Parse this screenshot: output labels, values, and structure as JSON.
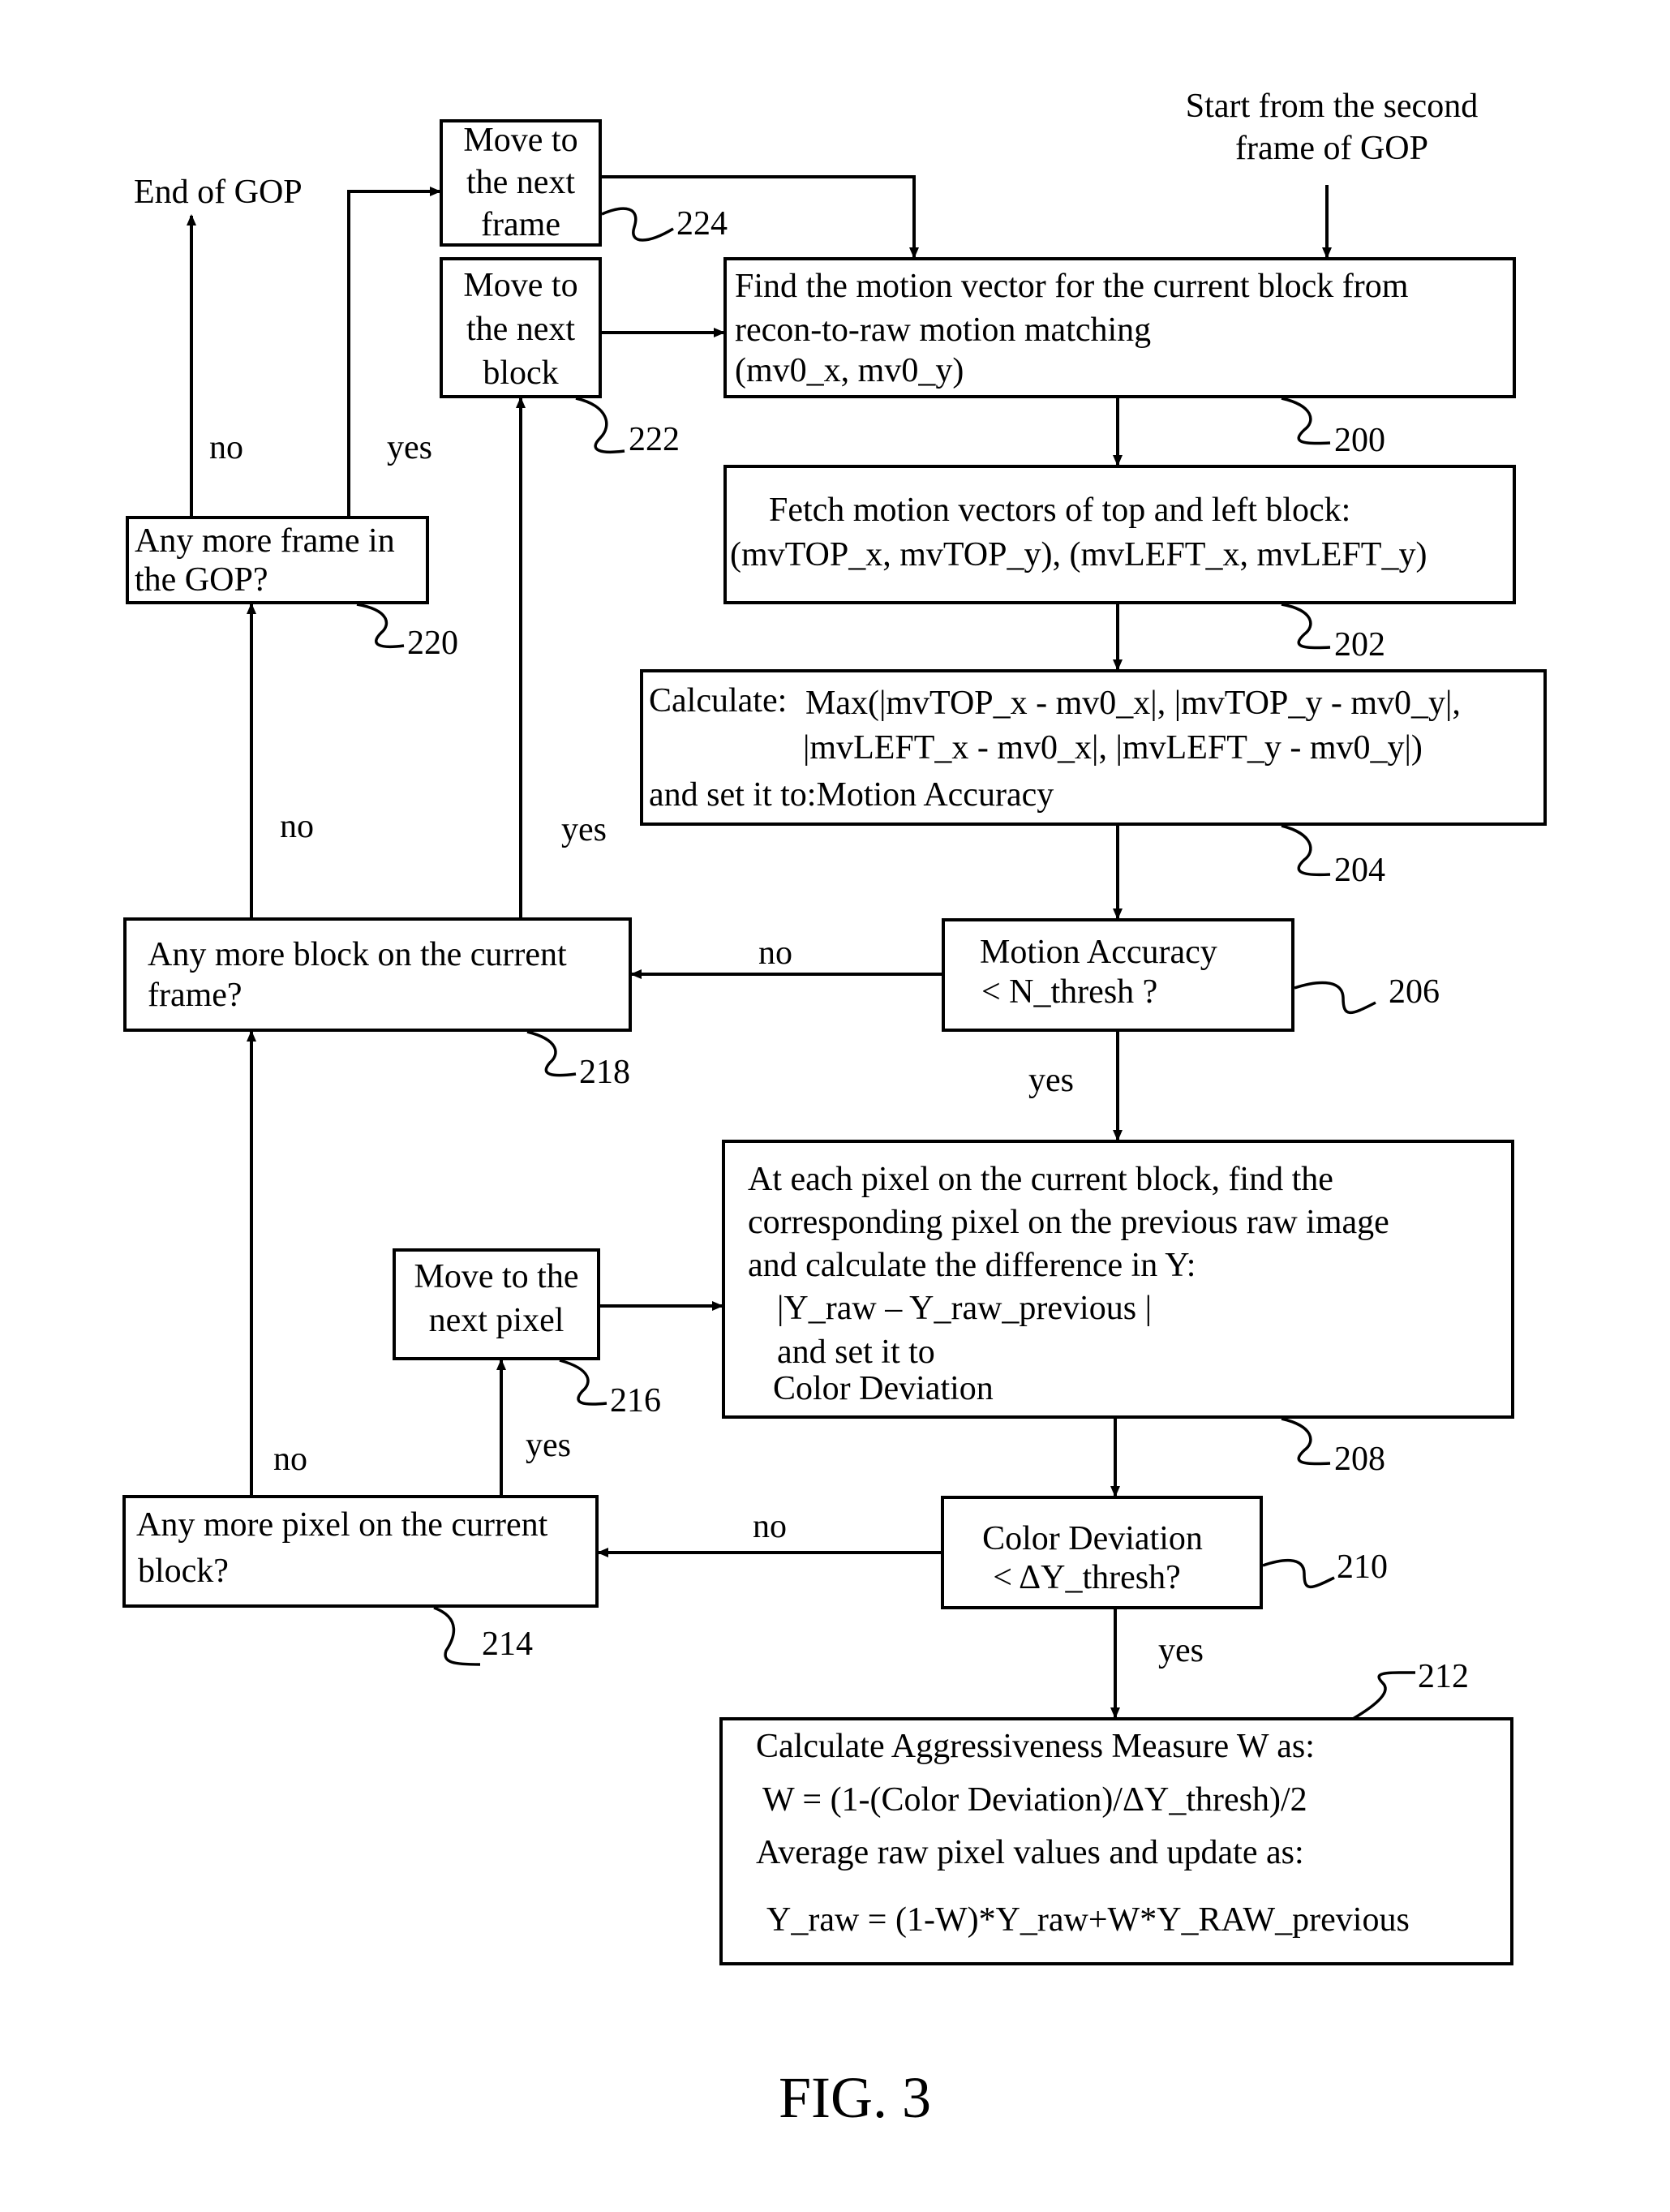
{
  "figure": {
    "label": "FIG. 3",
    "start_label": [
      "Start from the second",
      "frame of GOP"
    ],
    "end_label": "End of GOP"
  },
  "nodes": {
    "n200": {
      "ref": "200",
      "lines": [
        "Find the motion vector for the current block from",
        "recon-to-raw motion matching",
        "(mv0_x, mv0_y)"
      ]
    },
    "n202": {
      "ref": "202",
      "lines": [
        "Fetch motion vectors of top and left block:",
        "(mvTOP_x, mvTOP_y),  (mvLEFT_x, mvLEFT_y)"
      ]
    },
    "n204": {
      "ref": "204",
      "lines": [
        "Calculate:",
        "Max(|mvTOP_x -  mv0_x|, |mvTOP_y - mv0_y|,",
        "|mvLEFT_x -  mv0_x|, |mvLEFT_y - mv0_y|)",
        "and set it to:Motion Accuracy"
      ]
    },
    "n206": {
      "ref": "206",
      "lines": [
        "Motion Accuracy",
        "< N_thresh ?"
      ]
    },
    "n208": {
      "ref": "208",
      "lines": [
        "At each pixel on the current block, find the",
        "corresponding pixel on the previous raw image",
        "and calculate the difference in Y:",
        "|Y_raw – Y_raw_previous |",
        "and set it to",
        "Color Deviation"
      ]
    },
    "n210": {
      "ref": "210",
      "lines": [
        "Color Deviation",
        "< ΔY_thresh?"
      ]
    },
    "n212": {
      "ref": "212",
      "lines": [
        "Calculate   Aggressiveness Measure W  as:",
        "W = (1-(Color Deviation)/ΔY_thresh)/2",
        "Average raw pixel values and update as:",
        "Y_raw = (1-W)*Y_raw+W*Y_RAW_previous"
      ]
    },
    "n214": {
      "ref": "214",
      "lines": [
        "Any more pixel on the current",
        "block?"
      ]
    },
    "n216": {
      "ref": "216",
      "lines": [
        "Move to the",
        "next pixel"
      ]
    },
    "n218": {
      "ref": "218",
      "lines": [
        "Any more block on the current",
        "frame?"
      ]
    },
    "n220": {
      "ref": "220",
      "lines": [
        "Any more frame in",
        "the GOP?"
      ]
    },
    "n222": {
      "ref": "222",
      "lines": [
        "Move to",
        "the next",
        "block"
      ]
    },
    "n224": {
      "ref": "224",
      "lines": [
        "Move to",
        "the next",
        "frame"
      ]
    }
  },
  "edge_labels": {
    "e206_no": "no",
    "e206_yes": "yes",
    "e210_no": "no",
    "e210_yes": "yes",
    "e214_no": "no",
    "e214_yes": "yes",
    "e218_no": "no",
    "e218_yes": "yes",
    "e220_no": "no",
    "e220_yes": "yes"
  }
}
